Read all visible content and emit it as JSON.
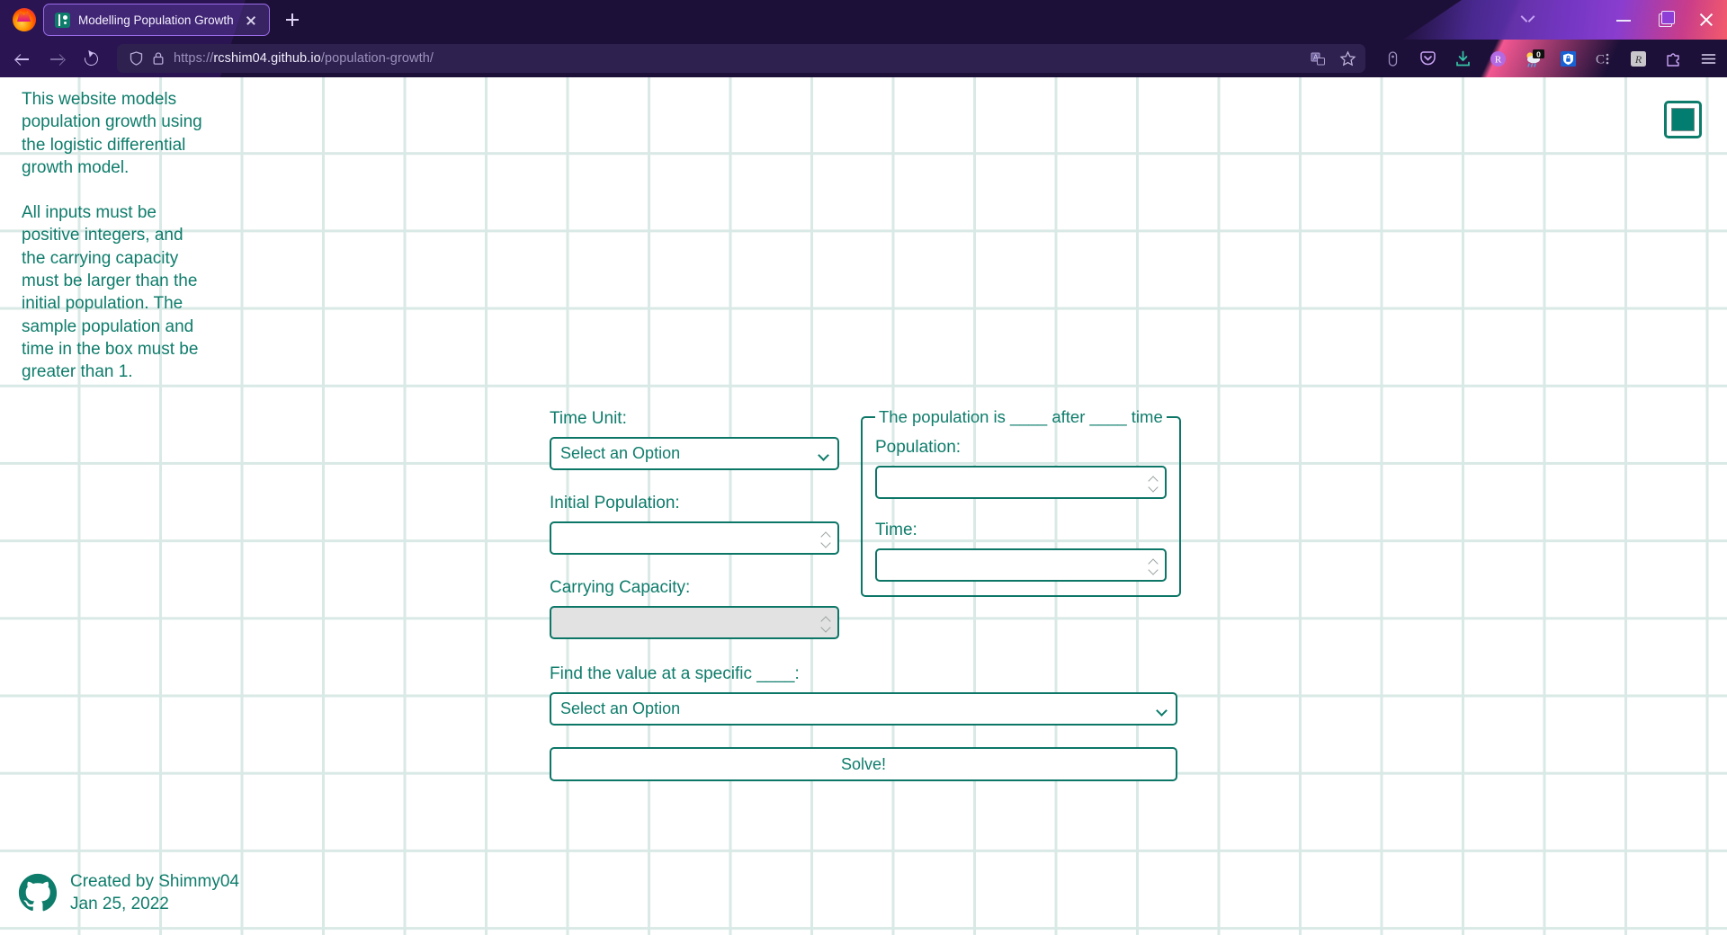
{
  "browser": {
    "tab": {
      "title": "Modelling Population Growth",
      "favicon_name": "population-growth-favicon",
      "close_label": "Close tab"
    },
    "new_tab_label": "New tab",
    "nav": {
      "back_label": "Back",
      "forward_label": "Forward",
      "reload_label": "Reload"
    },
    "url": {
      "scheme": "https://",
      "domain": "rcshim04.github.io",
      "path": "/population-growth/",
      "full": "https://rcshim04.github.io/population-growth/"
    },
    "url_icons": [
      "shield-icon",
      "lock-icon",
      "reader-view-icon",
      "bookmark-star-icon"
    ],
    "tray_icons": [
      "mouse-pointer-extension-icon",
      "pocket-icon",
      "downloads-icon",
      "r-extension-icon",
      "weather-extension-icon",
      "bitwarden-icon",
      "c-extension-icon",
      "gray-r-extension-icon",
      "extensions-puzzle-icon",
      "app-menu-icon"
    ],
    "weather_badge": "0",
    "window_controls": [
      "list-all-tabs-chevron",
      "minimize",
      "restore",
      "close"
    ]
  },
  "page": {
    "intro": {
      "paragraph1": "This website models population growth using the logistic differential growth model.",
      "paragraph2": "All inputs must be positive integers, and the carrying capacity must be larger than the initial population. The sample population and time in the box must be greater than 1."
    },
    "theme_toggle": {
      "name": "theme-toggle-button",
      "color": "#037d70"
    },
    "form": {
      "time_unit": {
        "label": "Time Unit:",
        "value": "Select an Option",
        "placeholder": "Select an Option"
      },
      "initial_population": {
        "label": "Initial Population:",
        "value": "",
        "placeholder": ""
      },
      "carrying_capacity": {
        "label": "Carrying Capacity:",
        "value": "",
        "placeholder": "",
        "disabled": true
      },
      "sample_box": {
        "legend": "The population is ____ after ____ time",
        "population": {
          "label": "Population:",
          "value": "",
          "placeholder": ""
        },
        "time": {
          "label": "Time:",
          "value": "",
          "placeholder": ""
        }
      },
      "find_value": {
        "label": "Find the value at a specific ____:",
        "value": "Select an Option",
        "placeholder": "Select an Option"
      },
      "solve_button": "Solve!"
    },
    "footer": {
      "icon_name": "github-octocat-icon",
      "author": "Created by Shimmy04",
      "date": "Jan 25, 2022"
    },
    "colors": {
      "teal": "#0e7c6b",
      "grid": "#d9e9e6",
      "chrome": "#1c0f33",
      "urlbar": "#2e2150"
    }
  }
}
